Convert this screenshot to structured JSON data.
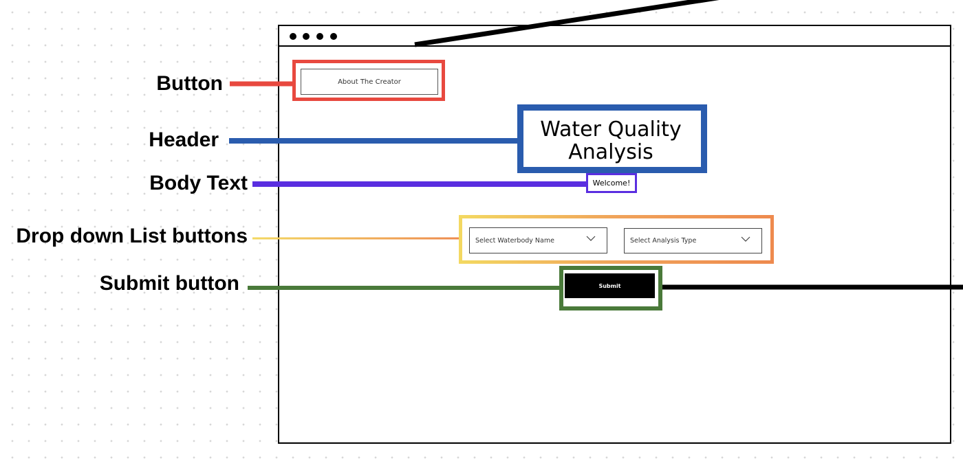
{
  "annotations": {
    "button": "Button",
    "header": "Header",
    "body_text": "Body Text",
    "dropdowns": "Drop down List buttons",
    "submit": "Submit button"
  },
  "wireframe": {
    "about_button": "About The Creator",
    "header": "Water Quality Analysis",
    "welcome": "Welcome!",
    "dropdown_waterbody": "Select Waterbody Name",
    "dropdown_analysis": "Select Analysis Type",
    "submit": "Submit"
  },
  "colors": {
    "button_annotation": "#e8493f",
    "header_annotation": "#2a5cae",
    "body_text_annotation": "#5a2ee0",
    "dropdown_annotation_start": "#f3d861",
    "dropdown_annotation_end": "#ee8a4e",
    "submit_annotation": "#4a7a3a"
  },
  "icons": [
    "window-dot-icon",
    "chevron-down-icon"
  ]
}
